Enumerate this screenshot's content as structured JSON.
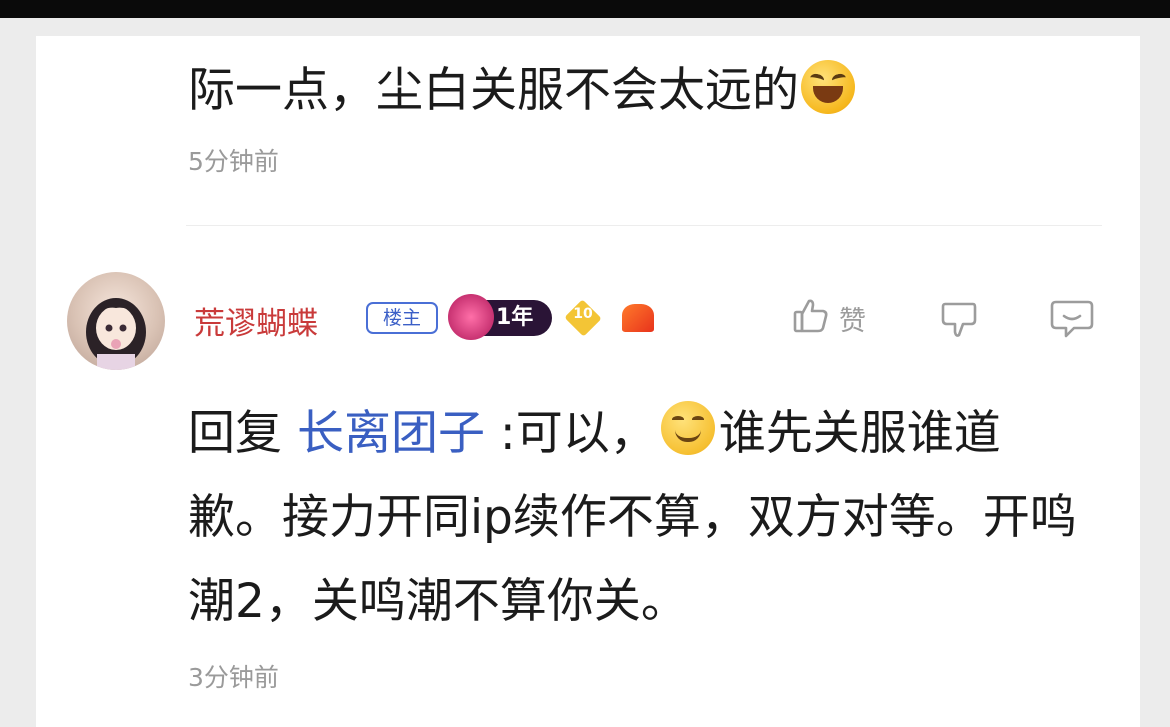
{
  "previous_comment": {
    "text": "际一点，尘白关服不会太远的",
    "emoji": "grinning-squint-emoji",
    "time": "5分钟前"
  },
  "comment": {
    "username": "荒谬蝴蝶",
    "owner_badge": "楼主",
    "year_badge": "1年",
    "level_badge": "10",
    "like_label": "赞",
    "reply_prefix": "回复",
    "mention": "长离团子",
    "text_before_emoji": " :可以，",
    "emoji": "smiling-face-emoji",
    "text_after_emoji": "谁先关服谁道歉。接力开同ip续作不算，双方对等。开鸣潮2，关鸣潮不算你关。",
    "time": "3分钟前"
  },
  "colors": {
    "username": "#c93a3a",
    "mention": "#3a5fc2",
    "owner_badge": "#3b5fc7",
    "timestamp": "#9a9a9a"
  }
}
